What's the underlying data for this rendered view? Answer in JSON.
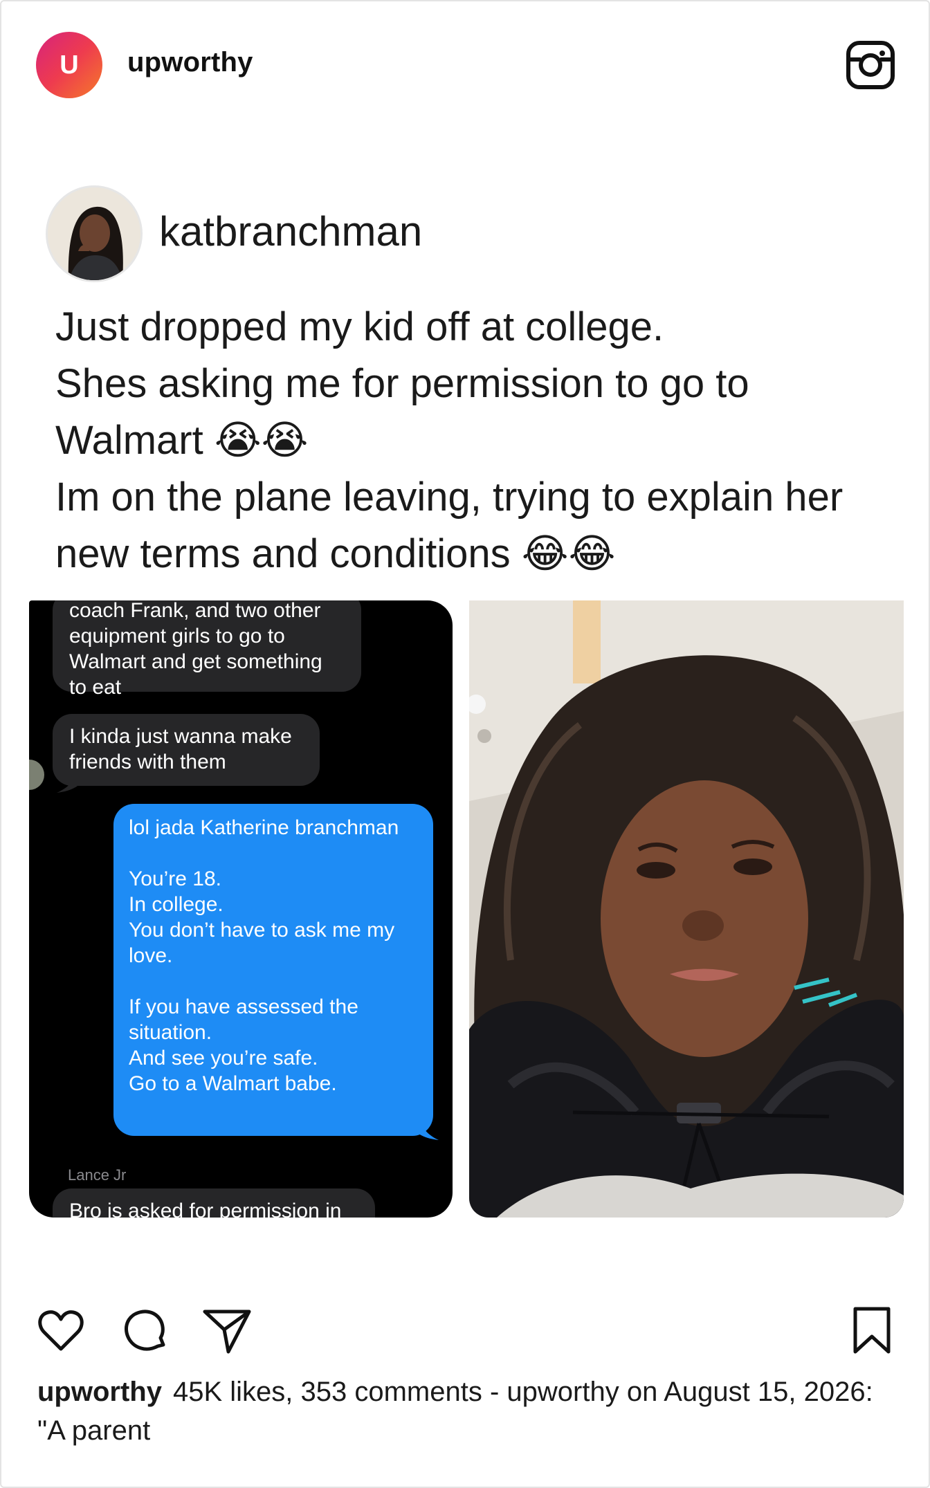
{
  "account": {
    "initial": "U",
    "name": "upworthy"
  },
  "post": {
    "username": "katbranchman",
    "caption": [
      "Just dropped my kid off at college.",
      "Shes asking me for permission to go to\nWalmart 😭😭",
      "Im on the plane leaving, trying to explain her\nnew terms and conditions 😂😂"
    ]
  },
  "messages": {
    "incoming_1": "coach Frank, and two other equipment girls to go to Walmart and get something to eat",
    "incoming_2": "I kinda just wanna make friends with them",
    "outgoing": "lol jada Katherine branchman\n\nYou’re 18.\nIn college.\nYou don’t have to ask me my love.\n\nIf you have assessed the situation.\nAnd see you’re safe.\nGo to a Walmart babe.",
    "sender_label": "Lance Jr",
    "incoming_3": "Bro is asked for permission in"
  },
  "footer": {
    "username": "upworthy",
    "text": "45K likes, 353 comments - upworthy on August 15, 2026: \"A parent"
  },
  "icons": {
    "instagram": "instagram-icon",
    "like": "heart-icon",
    "comment": "comment-icon",
    "share": "send-icon",
    "save": "bookmark-icon"
  },
  "colors": {
    "brand_gradient_start": "#d6247c",
    "brand_gradient_end": "#f57a2a",
    "imessage_blue": "#1e8cf5",
    "imessage_grey": "#262628"
  }
}
